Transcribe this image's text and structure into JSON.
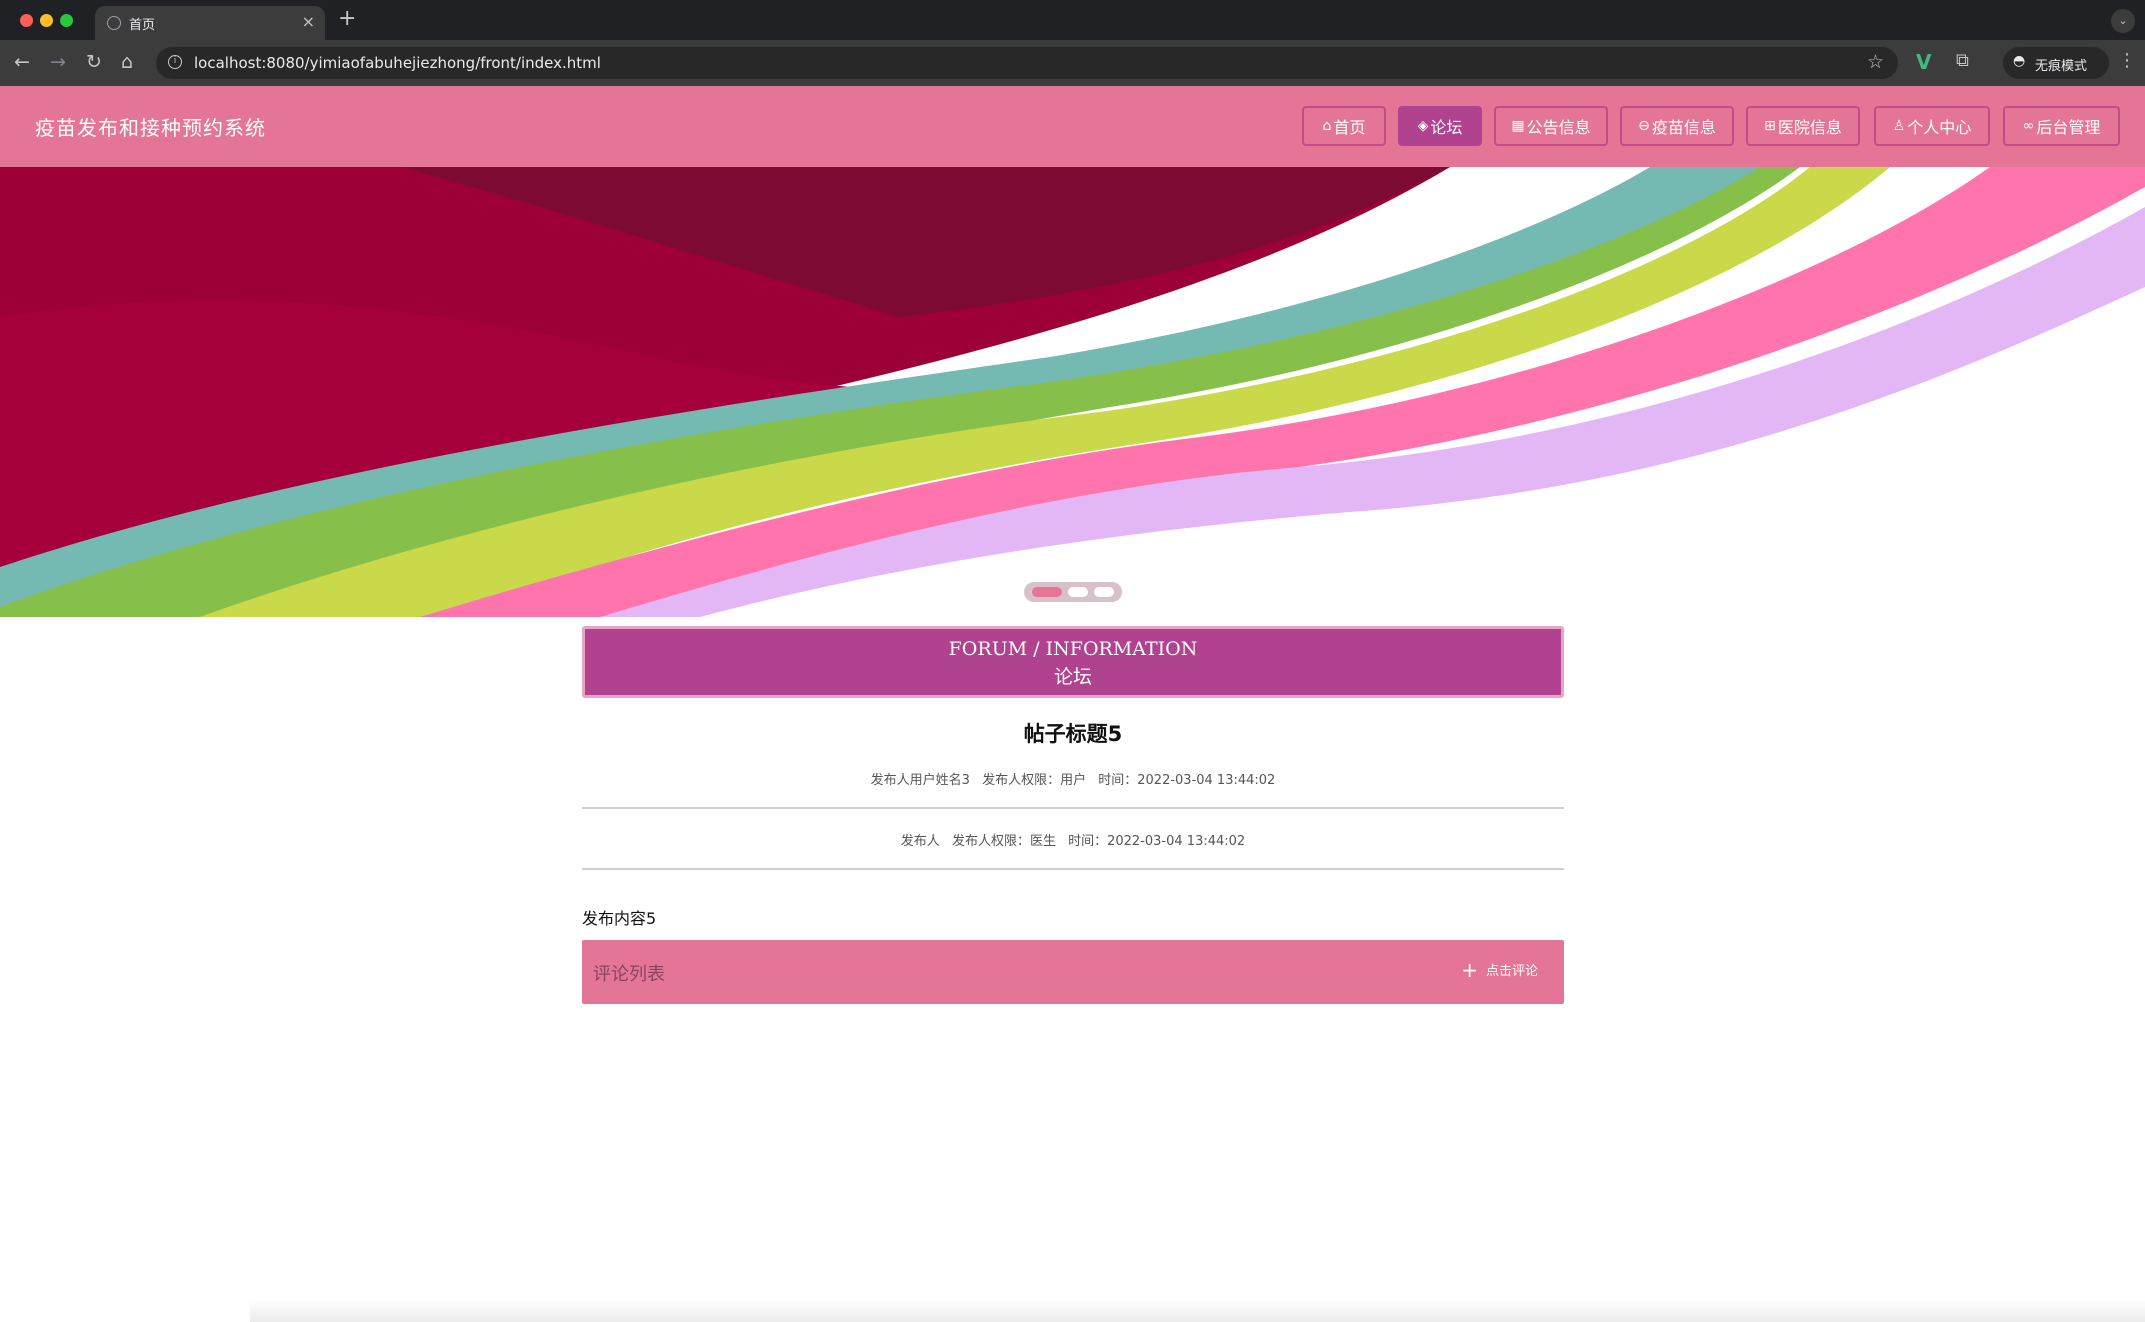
{
  "browser": {
    "tab_title": "首页",
    "tab_close": "×",
    "new_tab": "+",
    "tab_menu": "⌄",
    "url": "localhost:8080/yimiaofabuhejiezhong/front/index.html",
    "incognito_label": "无痕模式"
  },
  "header": {
    "site_title": "疫苗发布和接种预约系统",
    "nav": [
      {
        "label": "首页",
        "icon": "home-icon",
        "active": false
      },
      {
        "label": "论坛",
        "icon": "layers-icon",
        "active": true
      },
      {
        "label": "公告信息",
        "icon": "notice-icon",
        "active": false
      },
      {
        "label": "疫苗信息",
        "icon": "vaccine-icon",
        "active": false
      },
      {
        "label": "医院信息",
        "icon": "hospital-icon",
        "active": false
      },
      {
        "label": "个人中心",
        "icon": "user-icon",
        "active": false
      },
      {
        "label": "后台管理",
        "icon": "link-icon",
        "active": false
      }
    ]
  },
  "banner": {
    "slide_count": 3,
    "active_slide": 1
  },
  "section": {
    "title_en": "FORUM / INFORMATION",
    "title_cn": "论坛"
  },
  "post": {
    "title": "帖子标题5",
    "meta_author": "发布人用户姓名3",
    "meta_role": "发布人权限：用户",
    "meta_time": "时间：2022-03-04 13:44:02",
    "content": "发布内容5"
  },
  "reply": {
    "author": "发布人",
    "role": "发布人权限：医生",
    "time": "时间：2022-03-04 13:44:02"
  },
  "comments": {
    "title": "评论列表",
    "add_label": "点击评论"
  },
  "colors": {
    "header_bg": "#e57597",
    "active_nav": "#b0428f",
    "section_title_bg": "#b0428f",
    "comment_bar_bg": "#e57597"
  }
}
